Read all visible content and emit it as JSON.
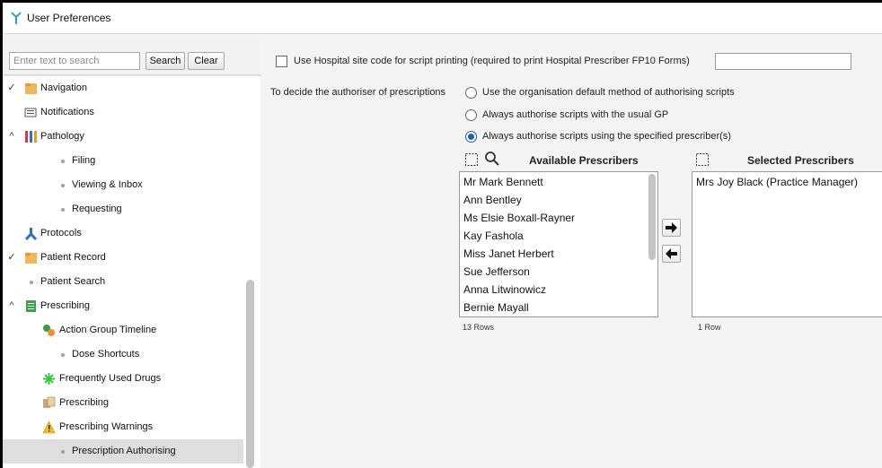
{
  "window": {
    "title": "User Preferences"
  },
  "search": {
    "placeholder": "Enter text to search",
    "value": "",
    "search_label": "Search",
    "clear_label": "Clear"
  },
  "tree": {
    "items": [
      {
        "label": "Navigation",
        "icon": "folder-icon",
        "expander": "chevron-down"
      },
      {
        "label": "Notifications",
        "icon": "notification-icon"
      },
      {
        "label": "Pathology",
        "icon": "test-tubes-icon",
        "expander": "chevron-up"
      },
      {
        "label": "Filing",
        "icon": "bullet"
      },
      {
        "label": "Viewing & Inbox",
        "icon": "bullet"
      },
      {
        "label": "Requesting",
        "icon": "bullet"
      },
      {
        "label": "Protocols",
        "icon": "protocols-icon"
      },
      {
        "label": "Patient Record",
        "icon": "folder-icon",
        "expander": "chevron-down"
      },
      {
        "label": "Patient Search",
        "icon": "bullet"
      },
      {
        "label": "Prescribing",
        "icon": "prescribing-group-icon",
        "expander": "chevron-up"
      },
      {
        "label": "Action Group Timeline",
        "icon": "action-group-icon"
      },
      {
        "label": "Dose Shortcuts",
        "icon": "bullet"
      },
      {
        "label": "Frequently Used Drugs",
        "icon": "star-burst-icon"
      },
      {
        "label": "Prescribing",
        "icon": "prescribing-icon"
      },
      {
        "label": "Prescribing Warnings",
        "icon": "warning-icon"
      },
      {
        "label": "Prescription Authorising",
        "icon": "bullet",
        "selected": true
      }
    ]
  },
  "prefs": {
    "site_code_label": "Use Hospital site code for script printing (required to print Hospital Prescriber FP10 Forms)",
    "site_code_value": "",
    "authoriser_label": "To decide the authoriser of prescriptions",
    "options": [
      "Use the organisation default method of authorising scripts",
      "Always authorise scripts with the usual GP",
      "Always authorise scripts using the specified prescriber(s)"
    ],
    "selected_option": 2
  },
  "available": {
    "header": "Available Prescribers",
    "items": [
      "Mr Mark Bennett",
      "Ann Bentley",
      "Ms Elsie Boxall-Rayner",
      "Kay Fashola",
      "Miss Janet Herbert",
      "Sue Jefferson",
      "Anna Litwinowicz",
      "Bernie Mayall"
    ],
    "row_count": "13 Rows"
  },
  "selected": {
    "header": "Selected Prescribers",
    "items": [
      "Mrs Joy Black (Practice Manager)"
    ],
    "row_count": "1 Row"
  },
  "colors": {
    "accent": "#1a5fb4",
    "selection": "#dedede",
    "frame": "#000000"
  }
}
